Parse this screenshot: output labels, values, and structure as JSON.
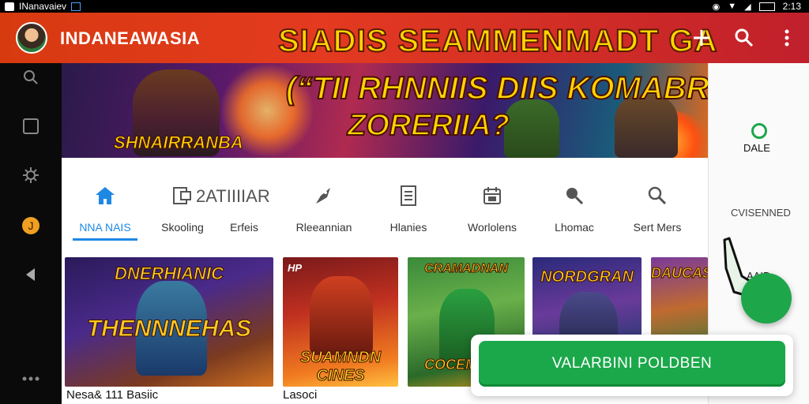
{
  "statusbar": {
    "app_name": "INanavaiev",
    "time": "2:13"
  },
  "appbar": {
    "title": "INDANEAWASIA",
    "banner_text": "SIADIS SEAMMENMADT GA"
  },
  "hero": {
    "headline": "(“TII RHNNIIS DIIS KOMABRG!",
    "subheadline": "ZORERIIA?",
    "overline": "SHNAIRRANBA"
  },
  "tabs": [
    {
      "label": "NNA NAIS",
      "sublabel": ""
    },
    {
      "label": "Skooling",
      "sublabel": "2ATIIIIAR"
    },
    {
      "label": "Erfeis",
      "sublabel": ""
    },
    {
      "label": "Rleeannian",
      "sublabel": ""
    },
    {
      "label": "Hlanies",
      "sublabel": ""
    },
    {
      "label": "Worlolens",
      "sublabel": ""
    },
    {
      "label": "Lhomac",
      "sublabel": ""
    },
    {
      "label": "Sert Mers",
      "sublabel": ""
    }
  ],
  "tiles": [
    {
      "title_top": "DNERHIANIC",
      "title_main": "THENNNEHAS",
      "caption": "Nesa& 111 Basiic"
    },
    {
      "title_top": "HP",
      "title_main": "SUAMNDN CINES",
      "caption": "Lasoci"
    },
    {
      "title_top": "CRAMADNAN",
      "title_main": "COCEMEMS",
      "caption": ""
    },
    {
      "title_top": "NORDGRAN",
      "title_main": "",
      "caption": ""
    },
    {
      "title_top": "DAUCAS",
      "title_main": "",
      "caption": ""
    }
  ],
  "rightpanel": {
    "item1": "DALE",
    "item2": "CVISENNED",
    "item3": "AAID"
  },
  "cta": {
    "label": "VALARBINI POLDBEN"
  },
  "colors": {
    "appbar": "#d83a10",
    "accent_blue": "#1e88e5",
    "cta_green": "#1ba84a",
    "banner_yellow": "#ffd400"
  }
}
